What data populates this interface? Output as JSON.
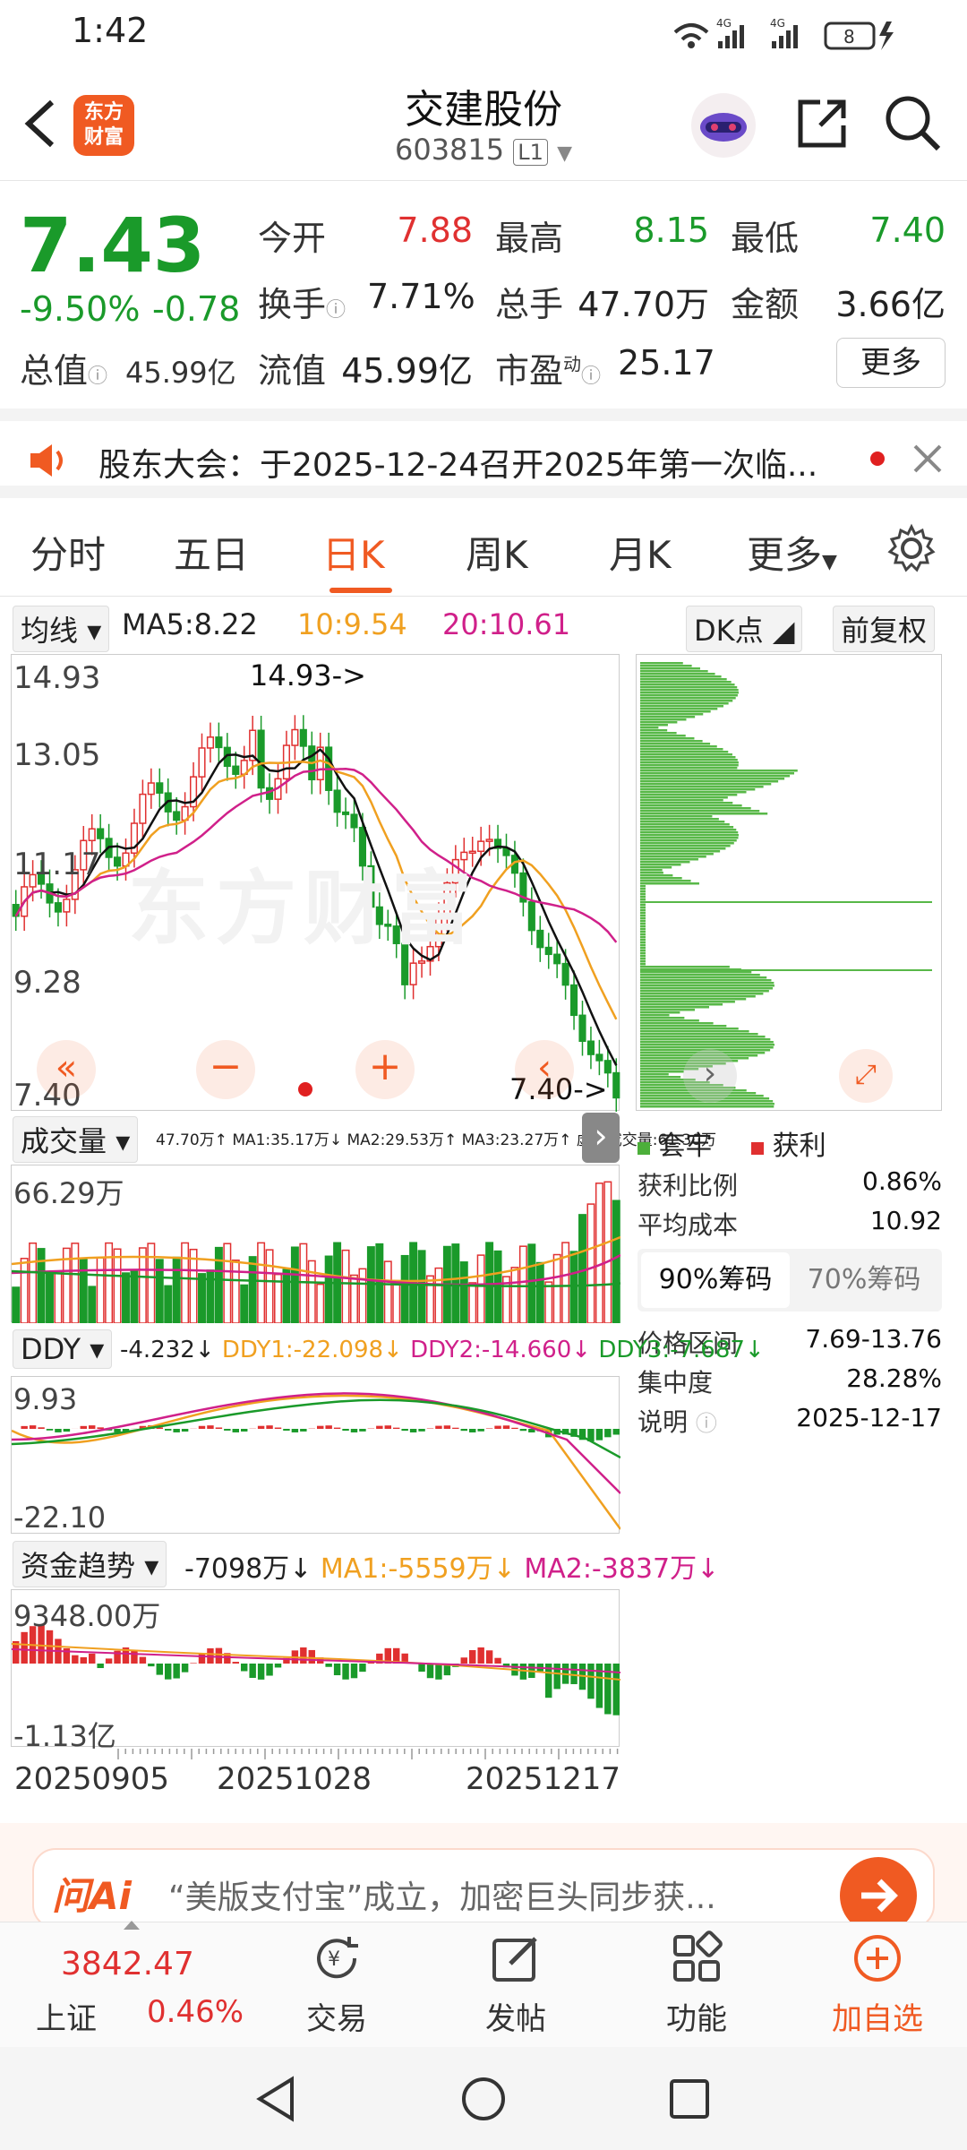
{
  "status_bar": {
    "time": "1:42",
    "network": "4G",
    "battery": "8"
  },
  "header": {
    "app_logo_line1": "东方",
    "app_logo_line2": "财富",
    "stock_name": "交建股份",
    "stock_code": "603815",
    "level_badge": "L1"
  },
  "quote": {
    "price": "7.43",
    "change_pct": "-9.50%",
    "change": "-0.78",
    "open_label": "今开",
    "open": "7.88",
    "high_label": "最高",
    "high": "8.15",
    "low_label": "最低",
    "low": "7.40",
    "turnover_label": "换手",
    "turnover": "7.71%",
    "volume_label": "总手",
    "volume": "47.70万",
    "amount_label": "金额",
    "amount": "3.66亿",
    "mktcap_label": "总值",
    "mktcap": "45.99亿",
    "float_label": "流值",
    "float_cap": "45.99亿",
    "pe_label": "市盈",
    "pe_sup": "动",
    "pe": "25.17",
    "more_label": "更多"
  },
  "notice": {
    "text": "股东大会：于2025-12-24召开2025年第一次临..."
  },
  "tabs": [
    "分时",
    "五日",
    "日K",
    "周K",
    "月K",
    "更多"
  ],
  "active_tab": "日K",
  "kline": {
    "ma_selector": "均线",
    "ma5": "MA5:8.22",
    "ma10": "10:9.54",
    "ma20": "20:10.61",
    "dk_label": "DK点",
    "adjust_label": "前复权",
    "y_labels": [
      "14.93",
      "13.05",
      "11.17",
      "9.28",
      "7.40"
    ],
    "high_marker": "14.93->",
    "low_marker": "7.40->",
    "watermark": "东方财富"
  },
  "chip": {
    "legend_locked": "套牢",
    "legend_profit": "获利",
    "rows": [
      {
        "label": "获利比例",
        "value": "0.86%"
      },
      {
        "label": "平均成本",
        "value": "10.92"
      }
    ],
    "tab90": "90%筹码",
    "tab70": "70%筹码",
    "rows2": [
      {
        "label": "价格区间",
        "value": "7.69-13.76"
      },
      {
        "label": "集中度",
        "value": "28.28%"
      },
      {
        "label": "说明",
        "value": "2025-12-17"
      }
    ]
  },
  "volume": {
    "selector": "成交量",
    "info": "47.70万↑ MA1:35.17万↓ MA2:29.53万↑ MA3:23.27万↑ 虚拟成交量:61.30万",
    "y_top": "66.29万"
  },
  "ddy": {
    "selector": "DDY",
    "v": "-4.232↓",
    "d1": "DDY1:-22.098↓",
    "d2": "DDY2:-14.660↓",
    "d3": "DDY3:-7.687↓",
    "y_top": "9.93",
    "y_bot": "-22.10"
  },
  "fund": {
    "selector": "资金趋势",
    "v": "-7098万↓",
    "ma1": "MA1:-5559万↓",
    "ma2": "MA2:-3837万↓",
    "y_top": "9348.00万",
    "y_bot": "-1.13亿"
  },
  "dates": [
    "20250905",
    "20251028",
    "20251217"
  ],
  "ai_bar": {
    "brand": "问Ai",
    "text": "“美版支付宝”成立，加密巨头同步获..."
  },
  "bottom_nav": {
    "index_value": "3842.47",
    "index_name": "上证",
    "index_pct": "0.46%",
    "trade": "交易",
    "post": "发帖",
    "function": "功能",
    "add": "加自选"
  },
  "colors": {
    "up": "#e03030",
    "down": "#1a9a2a",
    "accent": "#f05a22",
    "ma5": "#111111",
    "ma10": "#f0a020",
    "ma20": "#d0208a"
  }
}
